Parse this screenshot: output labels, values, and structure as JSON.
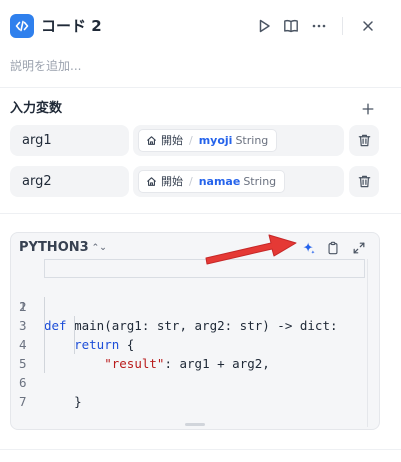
{
  "header": {
    "title": "コード 2",
    "icons": [
      "code-icon",
      "play-icon",
      "book-open-icon",
      "more-icon",
      "close-icon"
    ]
  },
  "description": {
    "placeholder": "説明を追加..."
  },
  "inputs": {
    "title": "入力変数",
    "items": [
      {
        "name": "arg1",
        "node": "開始",
        "variable": "myoji",
        "type": "String"
      },
      {
        "name": "arg2",
        "node": "開始",
        "variable": "namae",
        "type": "String"
      }
    ]
  },
  "code": {
    "language": "PYTHON3",
    "line_numbers": [
      "1",
      "2",
      "3",
      "4",
      "5",
      "6",
      "7"
    ],
    "lines": [
      "",
      "def main(arg1: str, arg2: str) -> dict:",
      "    return {",
      "        \"result\": arg1 + arg2,",
      "",
      "    }",
      ""
    ]
  },
  "colors": {
    "accent": "#2f80ed",
    "variable": "#2563eb",
    "annotation_arrow": "#e53935"
  }
}
